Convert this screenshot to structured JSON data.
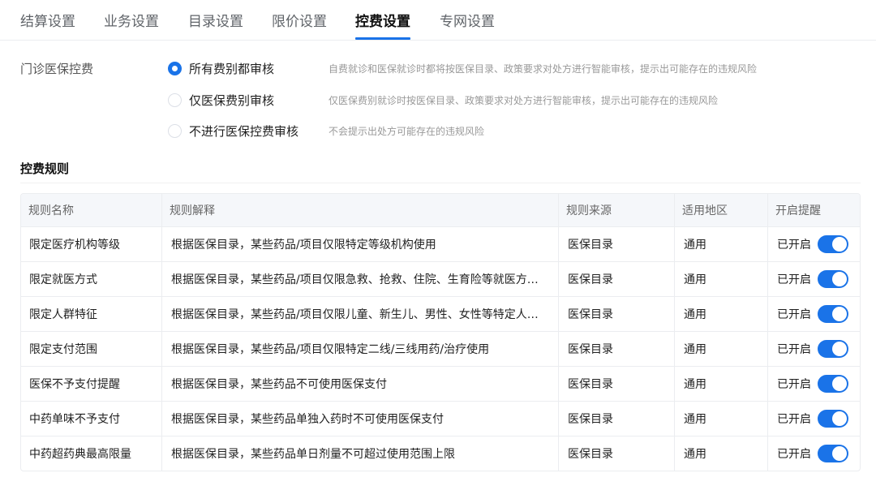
{
  "tabs": [
    {
      "label": "结算设置",
      "active": false
    },
    {
      "label": "业务设置",
      "active": false
    },
    {
      "label": "目录设置",
      "active": false
    },
    {
      "label": "限价设置",
      "active": false
    },
    {
      "label": "控费设置",
      "active": true
    },
    {
      "label": "专网设置",
      "active": false
    }
  ],
  "outpatient": {
    "label": "门诊医保控费",
    "options": [
      {
        "label": "所有费别都审核",
        "desc": "自费就诊和医保就诊时都将按医保目录、政策要求对处方进行智能审核，提示出可能存在的违规风险",
        "checked": true
      },
      {
        "label": "仅医保费别审核",
        "desc": "仅医保费别就诊时按医保目录、政策要求对处方进行智能审核，提示出可能存在的违规风险",
        "checked": false
      },
      {
        "label": "不进行医保控费审核",
        "desc": "不会提示出处方可能存在的违规风险",
        "checked": false
      }
    ]
  },
  "rules": {
    "title": "控费规则",
    "columns": [
      "规则名称",
      "规则解释",
      "规则来源",
      "适用地区",
      "开启提醒"
    ],
    "rows": [
      {
        "name": "限定医疗机构等级",
        "desc": "根据医保目录，某些药品/项目仅限特定等级机构使用",
        "source": "医保目录",
        "region": "通用",
        "status": "已开启",
        "on": true
      },
      {
        "name": "限定就医方式",
        "desc": "根据医保目录，某些药品/项目仅限急救、抢救、住院、生育险等就医方式使用",
        "source": "医保目录",
        "region": "通用",
        "status": "已开启",
        "on": true
      },
      {
        "name": "限定人群特征",
        "desc": "根据医保目录，某些药品/项目仅限儿童、新生儿、男性、女性等特定人群使用",
        "source": "医保目录",
        "region": "通用",
        "status": "已开启",
        "on": true
      },
      {
        "name": "限定支付范围",
        "desc": "根据医保目录，某些药品/项目仅限特定二线/三线用药/治疗使用",
        "source": "医保目录",
        "region": "通用",
        "status": "已开启",
        "on": true
      },
      {
        "name": "医保不予支付提醒",
        "desc": "根据医保目录，某些药品不可使用医保支付",
        "source": "医保目录",
        "region": "通用",
        "status": "已开启",
        "on": true
      },
      {
        "name": "中药单味不予支付",
        "desc": "根据医保目录，某些药品单独入药时不可使用医保支付",
        "source": "医保目录",
        "region": "通用",
        "status": "已开启",
        "on": true
      },
      {
        "name": "中药超药典最高限量",
        "desc": "根据医保目录，某些药品单日剂量不可超过使用范围上限",
        "source": "医保目录",
        "region": "通用",
        "status": "已开启",
        "on": true
      }
    ]
  },
  "colors": {
    "accent": "#1a73e8"
  }
}
